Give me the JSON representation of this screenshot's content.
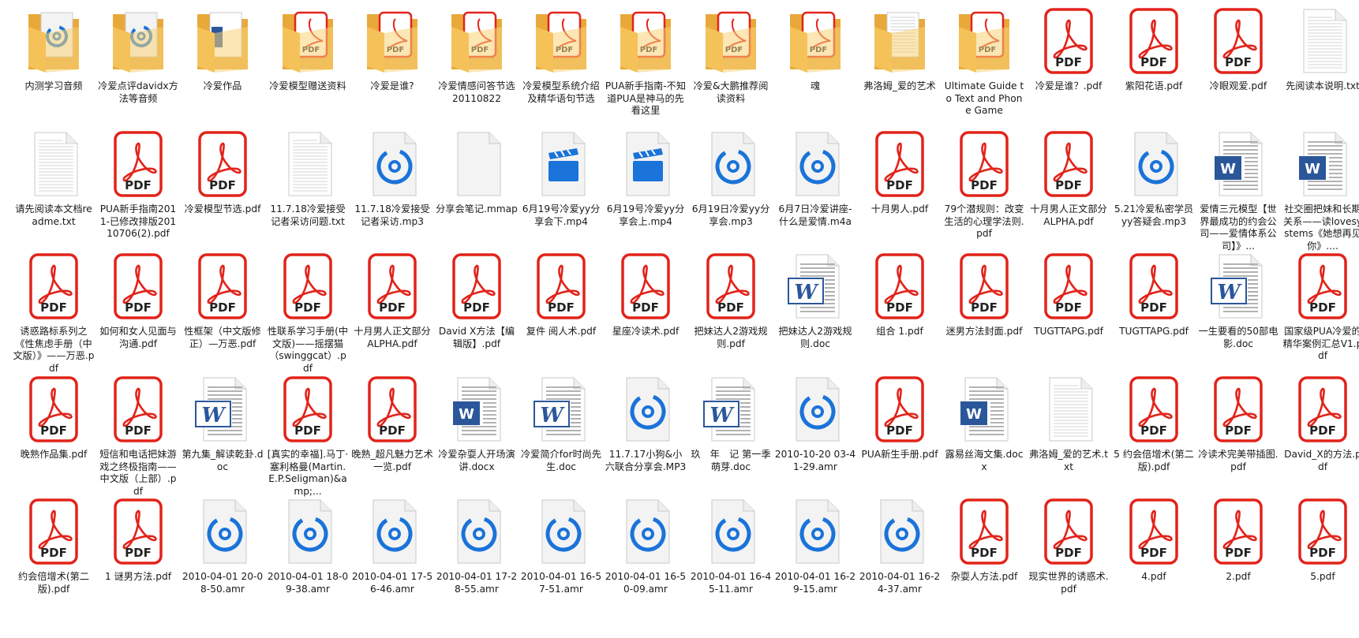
{
  "colors": {
    "pdf_red": "#e2231a",
    "folder": "#f5c25a",
    "audio_blue": "#1a73d9",
    "video_blue": "#1a73d9",
    "word_blue": "#2b579a"
  },
  "files": [
    {
      "name": "内测学习音频",
      "type": "folder",
      "content": "audio"
    },
    {
      "name": "冷爱点评davidx方法等音频",
      "type": "folder",
      "content": "audio"
    },
    {
      "name": "冷爱作品",
      "type": "folder",
      "content": "doc"
    },
    {
      "name": "冷爱模型赠送资料",
      "type": "folder",
      "content": "pdf"
    },
    {
      "name": "冷爱是谁?",
      "type": "folder",
      "content": "pdf"
    },
    {
      "name": "冷爱情感问答节选20110822",
      "type": "folder",
      "content": "pdf"
    },
    {
      "name": "冷爱模型系统介绍及精华语句节选",
      "type": "folder",
      "content": "pdf"
    },
    {
      "name": "PUA新手指南-不知道PUA是神马的先看这里",
      "type": "folder",
      "content": "pdf"
    },
    {
      "name": "冷爱&大鹏推荐阅读资料",
      "type": "folder",
      "content": "pdf"
    },
    {
      "name": "魂",
      "type": "folder",
      "content": "pdf"
    },
    {
      "name": "弗洛姆_爱的艺术",
      "type": "folder",
      "content": "txt"
    },
    {
      "name": "Ultimate Guide to Text and Phone Game",
      "type": "folder",
      "content": "pdf"
    },
    {
      "name": "冷爱是谁？.pdf",
      "type": "pdf"
    },
    {
      "name": "紫阳花语.pdf",
      "type": "pdf"
    },
    {
      "name": "冷眼观爱.pdf",
      "type": "pdf"
    },
    {
      "name": "先阅读本说明.txt",
      "type": "txt"
    },
    {
      "name": "请先阅读本文档readme.txt",
      "type": "txt"
    },
    {
      "name": "PUA新手指南2011-已修改排版20110706(2).pdf",
      "type": "pdf"
    },
    {
      "name": "冷爱模型节选.pdf",
      "type": "pdf"
    },
    {
      "name": "11.7.18冷爱接受记者采访问题.txt",
      "type": "txt"
    },
    {
      "name": "11.7.18冷爱接受记者采访.mp3",
      "type": "audio"
    },
    {
      "name": "分享会笔记.mmap",
      "type": "blank"
    },
    {
      "name": "6月19号冷爱yy分享会下.mp4",
      "type": "video"
    },
    {
      "name": "6月19号冷爱yy分享会上.mp4",
      "type": "video"
    },
    {
      "name": "6月19日冷爱yy分享会.mp3",
      "type": "audio"
    },
    {
      "name": "6月7日冷爱讲座-什么是爱情.m4a",
      "type": "audio"
    },
    {
      "name": "十月男人.pdf",
      "type": "pdf"
    },
    {
      "name": "79个潜规则：改变生活的心理学法则.pdf",
      "type": "pdf"
    },
    {
      "name": "十月男人正文部分ALPHA.pdf",
      "type": "pdf"
    },
    {
      "name": "5.21冷爱私密学员yy答疑会.mp3",
      "type": "audio"
    },
    {
      "name": "爱情三元模型【世界最成功的约会公司——爱情体系公司】》...",
      "type": "docx"
    },
    {
      "name": "社交圈把妹和长期关系——读lovesystems《她想再见你》....",
      "type": "docx"
    },
    {
      "name": "诱惑路标系列之《性焦虑手册（中文版）》——万恶.pdf",
      "type": "pdf"
    },
    {
      "name": "如何和女人见面与沟通.pdf",
      "type": "pdf"
    },
    {
      "name": "性框架（中文版修正）—万恶.pdf",
      "type": "pdf"
    },
    {
      "name": "性联系学习手册(中文版)——摇摆猫（swinggcat）.pdf",
      "type": "pdf"
    },
    {
      "name": "十月男人正文部分ALPHA.pdf",
      "type": "pdf"
    },
    {
      "name": "David X方法【编辑版】.pdf",
      "type": "pdf"
    },
    {
      "name": "复件 阅人术.pdf",
      "type": "pdf"
    },
    {
      "name": "星座冷读术.pdf",
      "type": "pdf"
    },
    {
      "name": "把妹达人2游戏规则.pdf",
      "type": "pdf"
    },
    {
      "name": "把妹达人2游戏规则.doc",
      "type": "doc"
    },
    {
      "name": "组合 1.pdf",
      "type": "pdf"
    },
    {
      "name": "迷男方法封面.pdf",
      "type": "pdf"
    },
    {
      "name": "TUGTTAPG.pdf",
      "type": "pdf"
    },
    {
      "name": "TUGTTAPG.pdf",
      "type": "pdf"
    },
    {
      "name": "一生要看的50部电影.doc",
      "type": "doc"
    },
    {
      "name": "国家级PUA冷爱的精华案例汇总V1.pdf",
      "type": "pdf"
    },
    {
      "name": "晚熟作品集.pdf",
      "type": "pdf"
    },
    {
      "name": "短信和电话把妹游戏之终极指南——中文版（上部）.pdf",
      "type": "pdf"
    },
    {
      "name": "第九集_解读乾卦.doc",
      "type": "doc"
    },
    {
      "name": "[真实的幸福].马丁·塞利格曼(Martin.E.P.Seligman)&amp;...",
      "type": "pdf"
    },
    {
      "name": "晚熟_超凡魅力艺术一览.pdf",
      "type": "pdf"
    },
    {
      "name": "冷爱杂耍人开场演讲.docx",
      "type": "docx"
    },
    {
      "name": "冷爱简介for时尚先生.doc",
      "type": "doc"
    },
    {
      "name": "11.7.17小狗&小六联合分享会.MP3",
      "type": "audio"
    },
    {
      "name": "玖　年　记 第一季 萌芽.doc",
      "type": "doc"
    },
    {
      "name": "2010-10-20 03-41-29.amr",
      "type": "audio"
    },
    {
      "name": "PUA新生手册.pdf",
      "type": "pdf"
    },
    {
      "name": "露易丝海文集.docx",
      "type": "docx"
    },
    {
      "name": "弗洛姆_爱的艺术.txt",
      "type": "txt"
    },
    {
      "name": "5 约会倍增术(第二版).pdf",
      "type": "pdf"
    },
    {
      "name": "冷读术完美带插图.pdf",
      "type": "pdf"
    },
    {
      "name": "David_X的方法.pdf",
      "type": "pdf"
    },
    {
      "name": "约会倍增术(第二版).pdf",
      "type": "pdf"
    },
    {
      "name": "1 谜男方法.pdf",
      "type": "pdf"
    },
    {
      "name": "2010-04-01 20-08-50.amr",
      "type": "audio"
    },
    {
      "name": "2010-04-01 18-09-38.amr",
      "type": "audio"
    },
    {
      "name": "2010-04-01 17-56-46.amr",
      "type": "audio"
    },
    {
      "name": "2010-04-01 17-28-55.amr",
      "type": "audio"
    },
    {
      "name": "2010-04-01 16-57-51.amr",
      "type": "audio"
    },
    {
      "name": "2010-04-01 16-50-09.amr",
      "type": "audio"
    },
    {
      "name": "2010-04-01 16-45-11.amr",
      "type": "audio"
    },
    {
      "name": "2010-04-01 16-29-15.amr",
      "type": "audio"
    },
    {
      "name": "2010-04-01 16-24-37.amr",
      "type": "audio"
    },
    {
      "name": "杂耍人方法.pdf",
      "type": "pdf"
    },
    {
      "name": "现实世界的诱惑术.pdf",
      "type": "pdf"
    },
    {
      "name": "4.pdf",
      "type": "pdf"
    },
    {
      "name": "2.pdf",
      "type": "pdf"
    },
    {
      "name": "5.pdf",
      "type": "pdf"
    }
  ]
}
